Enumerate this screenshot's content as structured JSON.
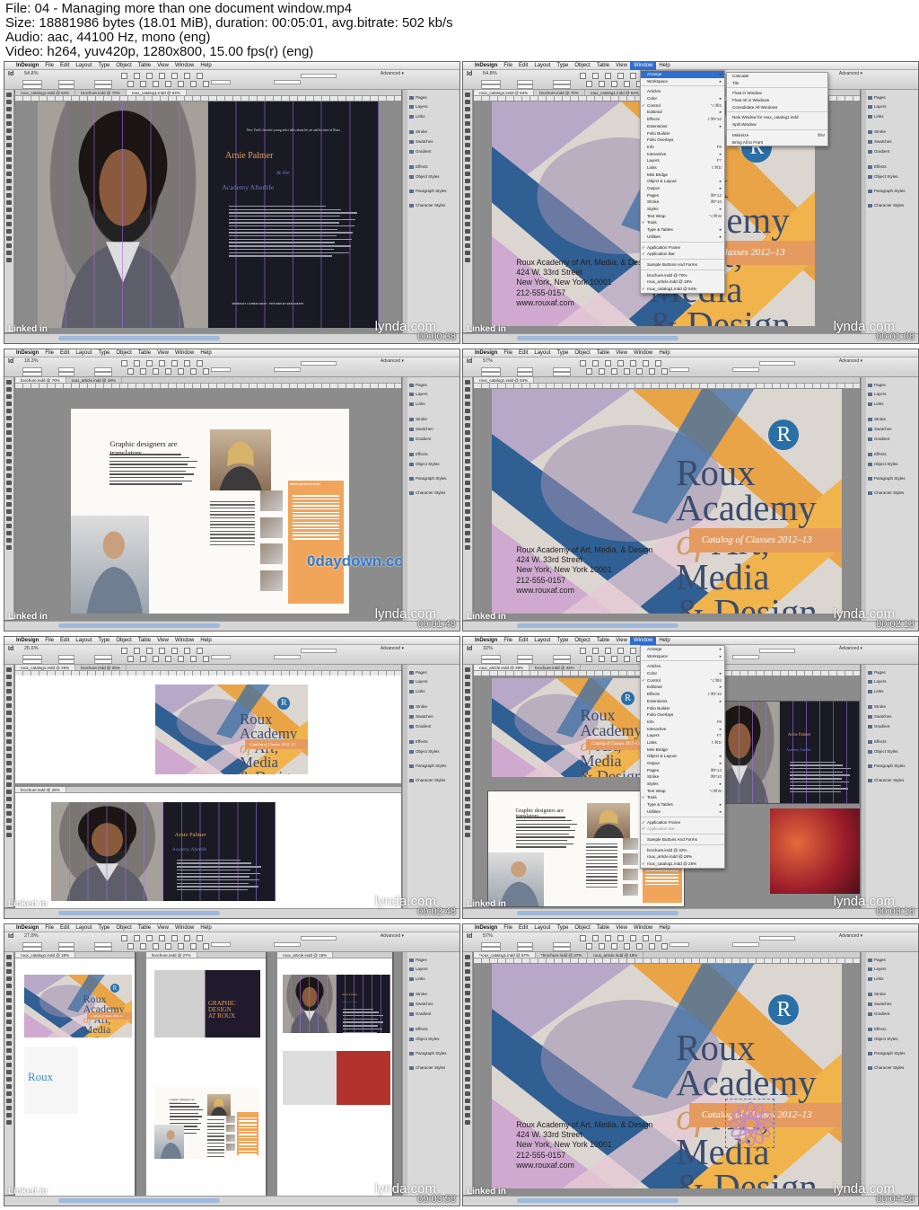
{
  "header": {
    "file": "File: 04 - Managing more than one document window.mp4",
    "size": "Size: 18881986 bytes (18.01 MiB), duration: 00:05:01, avg.bitrate: 502 kb/s",
    "audio": "Audio: aac, 44100 Hz, mono (eng)",
    "video": "Video: h264, yuv420p, 1280x800, 15.00 fps(r) (eng)"
  },
  "menu": {
    "app": "InDesign",
    "items": [
      "File",
      "Edit",
      "Layout",
      "Type",
      "Object",
      "Table",
      "View",
      "Window",
      "Help"
    ]
  },
  "panels": [
    "Pages",
    "Layers",
    "Links",
    "Stroke",
    "Swatches",
    "Gradient",
    "Effects",
    "Object Styles",
    "Paragraph Styles",
    "Character Styles"
  ],
  "watermark": {
    "lynda": "lynda.com",
    "linkedin": "Linked in",
    "daydown": "0daydown.com"
  },
  "window_menu": {
    "items": [
      {
        "label": "Arrange",
        "sub": true
      },
      {
        "label": "Workspace",
        "sub": true
      },
      {
        "sep": true
      },
      {
        "label": "Articles"
      },
      {
        "label": "Color",
        "sub": true
      },
      {
        "label": "Control",
        "check": true,
        "sc": "⌥⌘6"
      },
      {
        "label": "Editorial",
        "sub": true
      },
      {
        "label": "Effects",
        "sc": "⇧⌘F10"
      },
      {
        "label": "Extensions",
        "sub": true
      },
      {
        "label": "Folio Builder"
      },
      {
        "label": "Folio Overlays"
      },
      {
        "label": "Info",
        "sc": "F8"
      },
      {
        "label": "Interactive",
        "sub": true
      },
      {
        "label": "Layers",
        "sc": "F7"
      },
      {
        "label": "Links",
        "sc": "⇧⌘D"
      },
      {
        "label": "Mini Bridge"
      },
      {
        "label": "Object & Layout",
        "sub": true
      },
      {
        "label": "Output",
        "sub": true
      },
      {
        "label": "Pages",
        "sc": "⌘F12"
      },
      {
        "label": "Stroke",
        "sc": "⌘F10"
      },
      {
        "label": "Styles",
        "sub": true
      },
      {
        "label": "Text Wrap",
        "sc": "⌥⌘W"
      },
      {
        "label": "Tools",
        "check": true
      },
      {
        "label": "Type & Tables",
        "sub": true
      },
      {
        "label": "Utilities",
        "sub": true
      },
      {
        "sep": true
      },
      {
        "label": "Application Frame",
        "check": true
      },
      {
        "label": "Application Bar",
        "check": true
      },
      {
        "sep": true
      },
      {
        "label": "Sample Buttons And Forms"
      },
      {
        "sep": true
      },
      {
        "label": "brochure.indd @ 70%"
      },
      {
        "label": "roux_article.indd @ 18%"
      },
      {
        "label": "roux_catalog1.indd @ 54%",
        "check": true
      }
    ],
    "items2_docs": [
      "brochure.indd @ 32%",
      "roux_article.indd @ 28%",
      "roux_catalog1.indd @ 25%"
    ],
    "arrange": [
      "Cascade",
      "Tile",
      "Float in Window",
      "Float All in Windows",
      "Consolidate All Windows",
      "New Window for roux_catalog1.indd",
      "Split Window",
      "Minimize",
      "Bring All to Front"
    ],
    "arrange_sc": {
      "Minimize": "⌘M"
    }
  },
  "frames": [
    {
      "ts": "00:00:38",
      "zoom": "54.8%",
      "tabs": [
        "roux_catalog1.indd @ 54%",
        "brochure.indd @ 70%",
        "roux_catalog1.indd @ 54%"
      ]
    },
    {
      "ts": "00:01:08",
      "zoom": "54.8%",
      "tabs": [
        "roux_catalog1.indd @ 54%",
        "brochure.indd @ 70%",
        "roux_catalog1.indd @ 54%"
      ]
    },
    {
      "ts": "00:01:48",
      "zoom": "18.3%",
      "tabs": [
        "brochure.indd @ 70%",
        "roux_article.indd @ 18%"
      ]
    },
    {
      "ts": "00:02:18",
      "zoom": "57%",
      "tabs": [
        "roux_catalog1.indd @ 54%"
      ]
    },
    {
      "ts": "00:02:48",
      "zoom": "25.6%",
      "tabs": [
        "roux_catalog1.indd @ 25%",
        "brochure.indd @ 25%"
      ]
    },
    {
      "ts": "00:03:18",
      "zoom": "32%",
      "tabs": [
        "roux_article.indd @ 28%",
        "brochure.indd @ 32%"
      ]
    },
    {
      "ts": "00:03:58",
      "zoom": "27.8%",
      "tabs": [
        "roux_catalog1.indd @ 18%",
        "brochure.indd @ 27%",
        "roux_article.indd @ 18%"
      ]
    },
    {
      "ts": "00:04:28",
      "zoom": "57%",
      "tabs": [
        "*roux_catalog1.indd @ 57%",
        "*brochure.indd @ 27%",
        "roux_article.indd @ 18%"
      ]
    }
  ],
  "article": {
    "intro": "New York's favorite young artist talks about his art and his time at Roux",
    "name": "Arnie Palmer",
    "and": "& the",
    "sub": "Academy Afterlife",
    "credit": "WORDS BY LAUREN GHEST · PICTURES BY BEN GUESTS"
  },
  "catalog": {
    "title1": "Roux",
    "title2": "Academy",
    "title3": "of",
    "title4": "Art,",
    "title5": "Media",
    "title6": "& Design",
    "badge": "R",
    "ribbon": "Catalog of Classes 2012–13",
    "addr1": "Roux Academy of Art, Media, & Design",
    "addr2": "424 W. 33rd Street",
    "addr3": "New York, New York 10001",
    "addr4": "212-555-0157",
    "addr5": "www.rouxaf.com"
  },
  "brochure": {
    "headline": "Graphic designers are translators.",
    "headline_small": "Graphic designers are translators",
    "spot": "SPOTLIGHTING AT ROUX",
    "roux": "Roux",
    "graphic1": "GRAPHIC",
    "graphic2": "DESIGN",
    "graphic3": "AT ROUX"
  }
}
